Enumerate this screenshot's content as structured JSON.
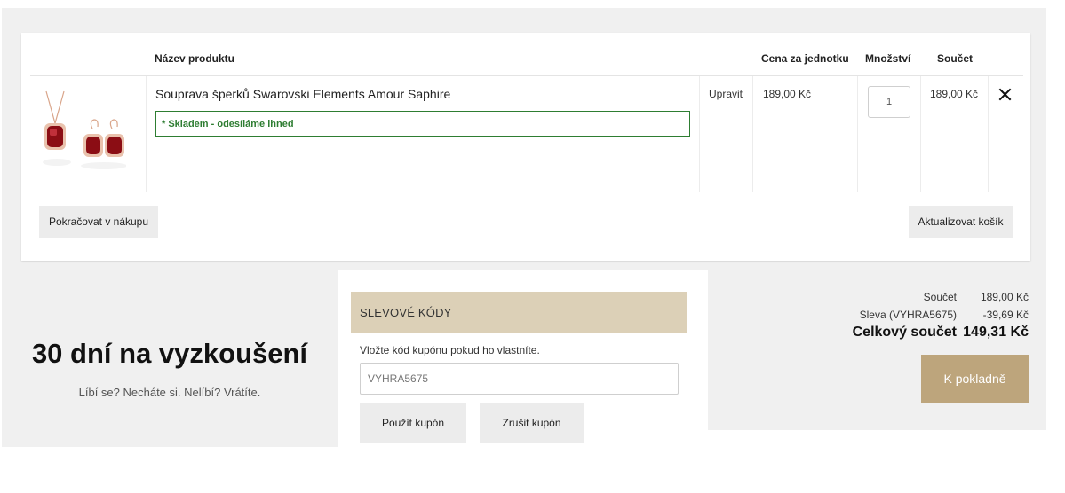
{
  "cart": {
    "headers": {
      "product_name": "Název produktu",
      "unit_price": "Cena za jednotku",
      "quantity": "Množství",
      "subtotal": "Součet"
    },
    "items": [
      {
        "name": "Souprava šperků Swarovski Elements Amour Saphire",
        "stock_status": "* Skladem - odesíláme ihned",
        "edit_label": "Upravit",
        "unit_price": "189,00 Kč",
        "quantity": "1",
        "subtotal": "189,00 Kč",
        "remove_icon": "close-icon"
      }
    ],
    "continue_label": "Pokračovat v nákupu",
    "update_label": "Aktualizovat košík"
  },
  "promo": {
    "title": "30 dní na vyzkoušení",
    "subtitle": "Líbí se? Necháte si. Nelíbí? Vrátíte."
  },
  "coupons": {
    "heading": "SLEVOVÉ KÓDY",
    "label": "Vložte kód kupónu pokud ho vlastníte.",
    "value": "VYHRA5675",
    "apply_label": "Použít kupón",
    "cancel_label": "Zrušit kupón"
  },
  "totals": {
    "subtotal_label": "Součet",
    "subtotal_value": "189,00 Kč",
    "discount_label": "Sleva (VYHRA5675)",
    "discount_value": "-39,69 Kč",
    "grand_label": "Celkový součet",
    "grand_value": "149,31 Kč",
    "checkout_label": "K pokladně"
  },
  "colors": {
    "stock_green": "#2e7d32",
    "coupon_header_bg": "#dcd0b7",
    "checkout_bg": "#bda57c",
    "panel_grey": "#f0f0f0"
  }
}
